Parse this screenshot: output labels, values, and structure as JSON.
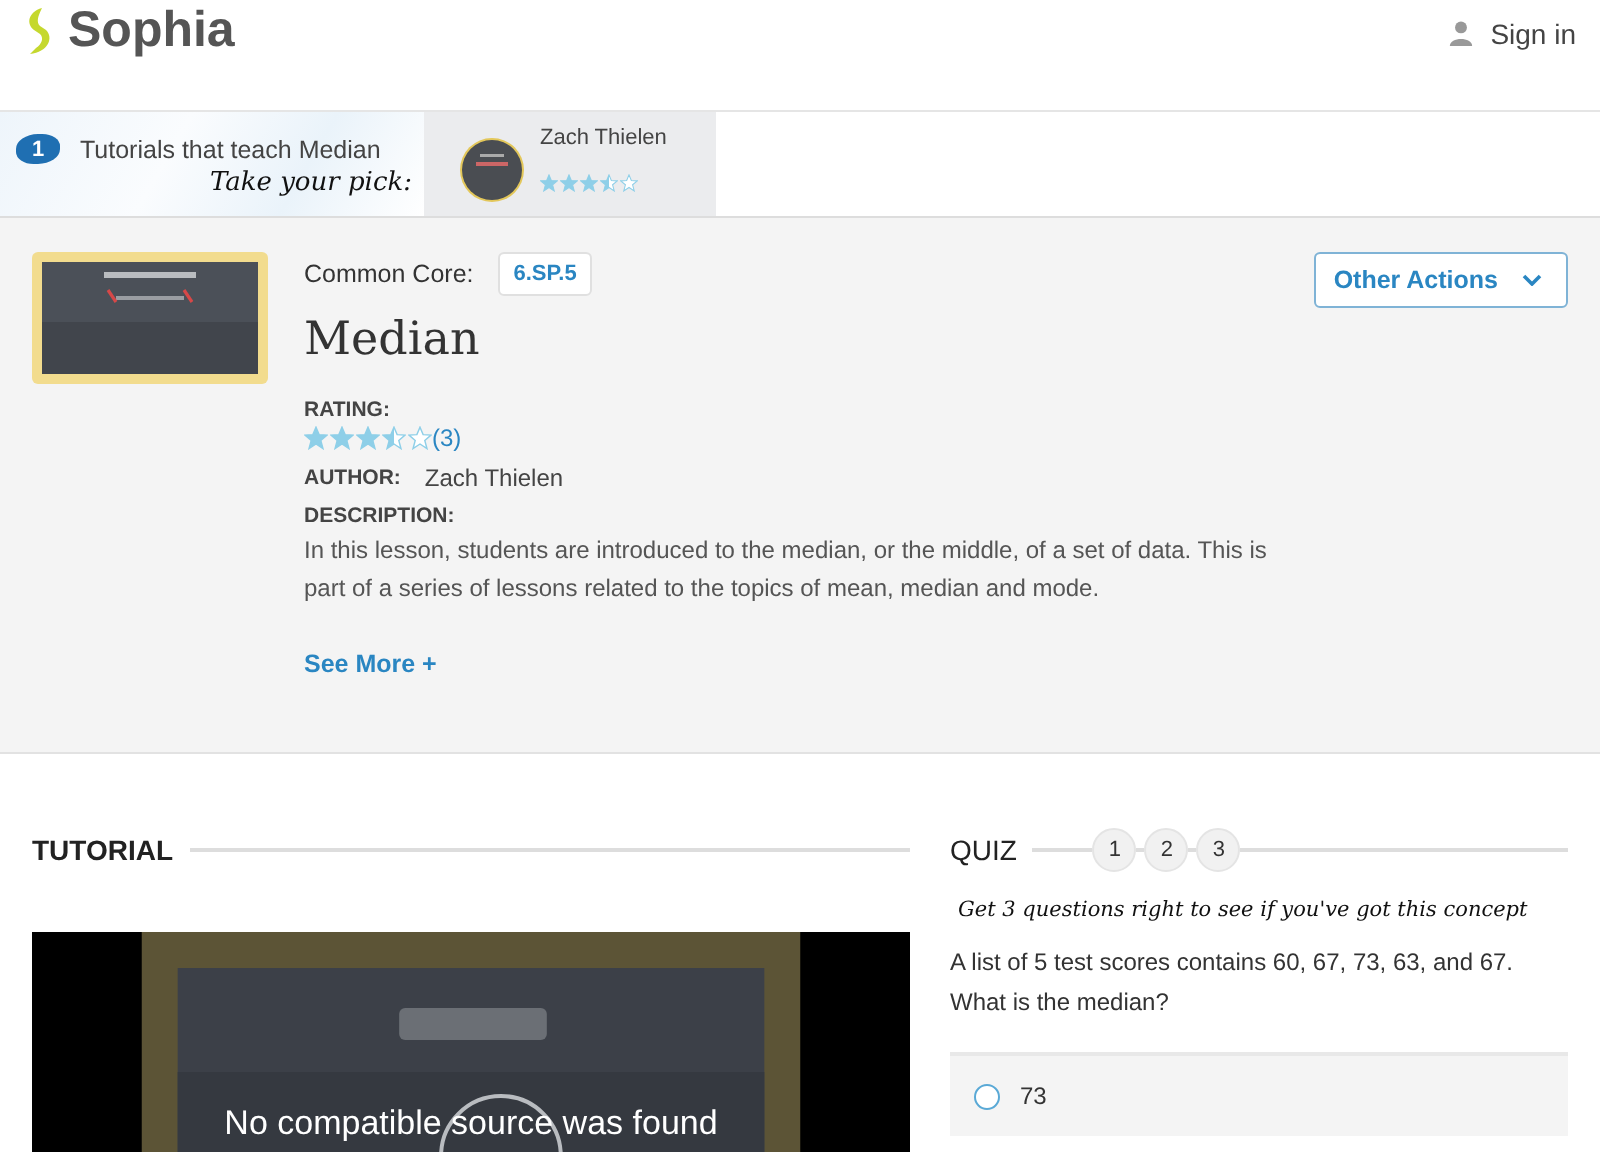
{
  "header": {
    "logo": "Sophia",
    "sign_in": "Sign in"
  },
  "tutorials_strip": {
    "count": "1",
    "label": "Tutorials that teach Median",
    "hint": "Take your pick:",
    "items": [
      {
        "author": "Zach Thielen",
        "stars": 3.5,
        "selected": true
      }
    ]
  },
  "lesson": {
    "standard_label": "Common Core:",
    "standard": "6.SP.5",
    "title": "Median",
    "actions": "Other Actions",
    "rating_label": "RATING:",
    "stars": 3.5,
    "rating_count": "(3)",
    "author_label": "AUTHOR:",
    "author": "Zach Thielen",
    "description_label": "DESCRIPTION:",
    "description": "In this lesson, students are introduced to the median, or the middle, of a set of data. This is part of a series of lessons related to the topics of mean, median and mode.",
    "see_more": "See More +"
  },
  "tutorial": {
    "heading": "TUTORIAL",
    "player_message": "No compatible source was found"
  },
  "quiz": {
    "heading": "QUIZ",
    "steps": [
      {
        "label": "1",
        "selected": false
      },
      {
        "label": "2",
        "selected": false
      },
      {
        "label": "3",
        "selected": false
      }
    ],
    "prompt": "Get 3 questions right to see if you've got this concept",
    "question": "A list of 5 test scores contains 60, 67, 73, 63, and 67. What is the median?",
    "answers": [
      {
        "label": "73",
        "selected": false
      }
    ]
  }
}
